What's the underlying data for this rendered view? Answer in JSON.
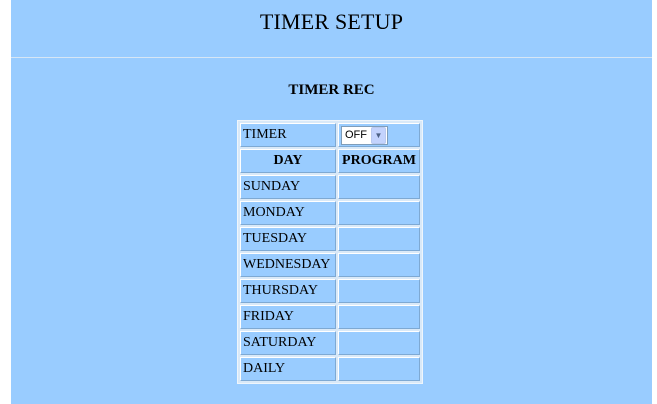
{
  "page": {
    "title": "TIMER SETUP"
  },
  "section": {
    "title": "TIMER REC"
  },
  "timer": {
    "label": "TIMER",
    "selected": "OFF"
  },
  "table": {
    "headers": {
      "day": "DAY",
      "program": "PROGRAM"
    },
    "rows": [
      {
        "day": "SUNDAY",
        "program": ""
      },
      {
        "day": "MONDAY",
        "program": ""
      },
      {
        "day": "TUESDAY",
        "program": ""
      },
      {
        "day": "WEDNESDAY",
        "program": ""
      },
      {
        "day": "THURSDAY",
        "program": ""
      },
      {
        "day": "FRIDAY",
        "program": ""
      },
      {
        "day": "SATURDAY",
        "program": ""
      },
      {
        "day": "DAILY",
        "program": ""
      }
    ]
  },
  "colors": {
    "background": "#99ccff",
    "cell_border_light": "#ffffff",
    "cell_border_dark": "#7ea9d3"
  },
  "icons": {
    "dropdown": "chevron-down-icon"
  }
}
